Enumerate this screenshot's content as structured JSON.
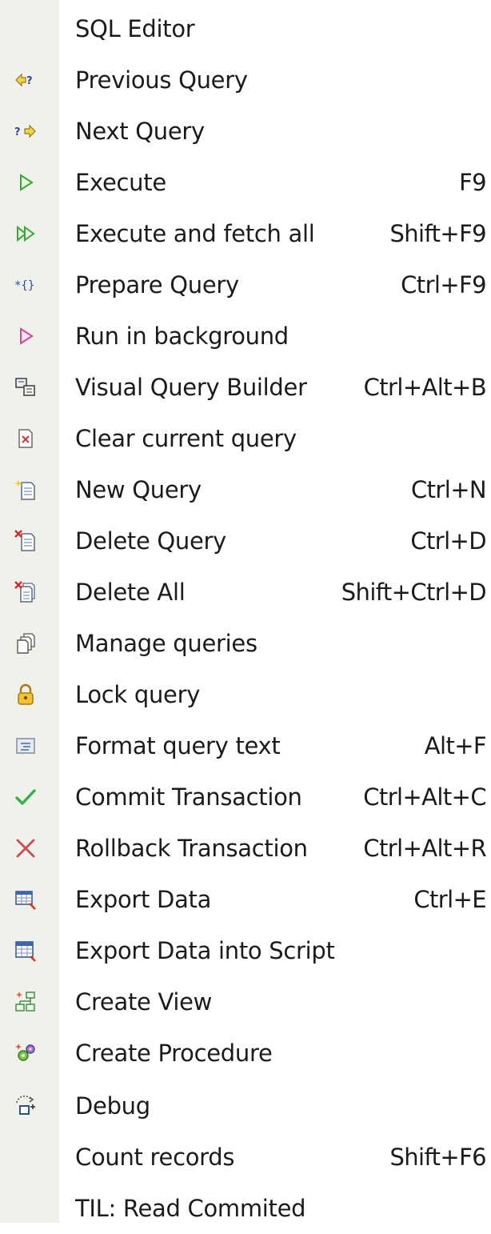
{
  "menu": {
    "items": [
      {
        "label": "SQL Editor",
        "shortcut": "",
        "icon": "none"
      },
      {
        "label": "Previous Query",
        "shortcut": "",
        "icon": "previous-query-icon"
      },
      {
        "label": "Next Query",
        "shortcut": "",
        "icon": "next-query-icon"
      },
      {
        "label": "Execute",
        "shortcut": "F9",
        "icon": "execute-icon"
      },
      {
        "label": "Execute and fetch all",
        "shortcut": "Shift+F9",
        "icon": "execute-fetch-all-icon"
      },
      {
        "label": "Prepare Query",
        "shortcut": "Ctrl+F9",
        "icon": "prepare-query-icon"
      },
      {
        "label": "Run in background",
        "shortcut": "",
        "icon": "run-background-icon"
      },
      {
        "label": "Visual Query Builder",
        "shortcut": "Ctrl+Alt+B",
        "icon": "query-builder-icon"
      },
      {
        "label": "Clear current query",
        "shortcut": "",
        "icon": "clear-query-icon"
      },
      {
        "label": "New Query",
        "shortcut": "Ctrl+N",
        "icon": "new-query-icon"
      },
      {
        "label": "Delete Query",
        "shortcut": "Ctrl+D",
        "icon": "delete-query-icon"
      },
      {
        "label": "Delete All",
        "shortcut": "Shift+Ctrl+D",
        "icon": "delete-all-icon"
      },
      {
        "label": "Manage queries",
        "shortcut": "",
        "icon": "manage-queries-icon"
      },
      {
        "label": "Lock query",
        "shortcut": "",
        "icon": "lock-icon"
      },
      {
        "label": "Format query text",
        "shortcut": "Alt+F",
        "icon": "format-text-icon"
      },
      {
        "label": "Commit Transaction",
        "shortcut": "Ctrl+Alt+C",
        "icon": "check-icon"
      },
      {
        "label": "Rollback Transaction",
        "shortcut": "Ctrl+Alt+R",
        "icon": "cross-icon"
      },
      {
        "label": "Export Data",
        "shortcut": "Ctrl+E",
        "icon": "export-data-icon"
      },
      {
        "label": "Export Data into Script",
        "shortcut": "",
        "icon": "export-script-icon"
      },
      {
        "label": "Create View",
        "shortcut": "",
        "icon": "create-view-icon"
      },
      {
        "label": "Create Procedure",
        "shortcut": "",
        "icon": "create-procedure-icon"
      },
      {
        "label": "Debug",
        "shortcut": "",
        "icon": "debug-icon"
      },
      {
        "label": "Count records",
        "shortcut": "Shift+F6",
        "icon": "none"
      },
      {
        "label": "TIL: Read Commited",
        "shortcut": "",
        "icon": "none"
      }
    ]
  },
  "colors": {
    "gutter": "#f1f1ec",
    "text": "#1b1b1b",
    "execute_green": "#3aa63a",
    "background_pink": "#d04a9a",
    "commit_green": "#33b24a",
    "rollback_red": "#d24a4a",
    "lock_gold": "#d7a21c"
  }
}
